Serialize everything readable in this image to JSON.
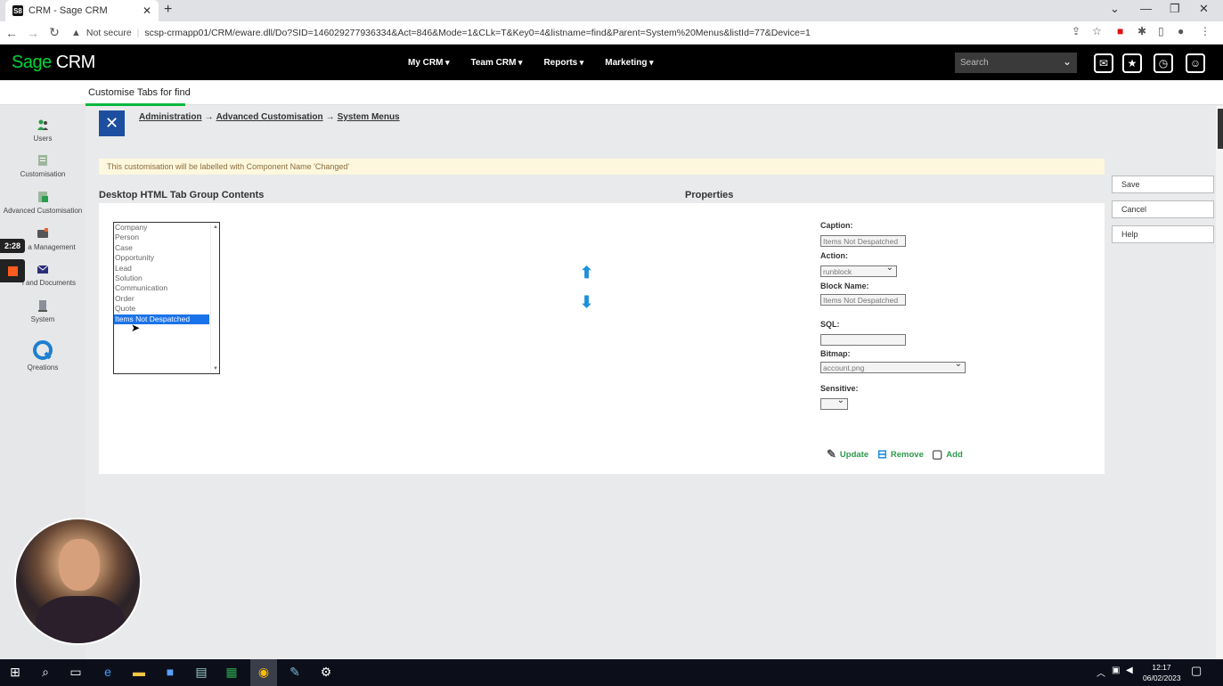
{
  "browser": {
    "tab_title": "CRM - Sage CRM",
    "tab_favicon": "S8",
    "new_tab": "+",
    "not_secure": "Not secure",
    "url": "scsp-crmapp01/CRM/eware.dll/Do?SID=146029277936334&Act=846&Mode=1&CLk=T&Key0=4&listname=find&Parent=System%20Menus&listId=77&Device=1"
  },
  "header": {
    "logo_sage": "Sage",
    "logo_crm": " CRM",
    "nav": [
      "My CRM",
      "Team CRM",
      "Reports",
      "Marketing"
    ],
    "search_placeholder": "Search"
  },
  "subheader": {
    "title": "Customise Tabs for find"
  },
  "sidebar": {
    "items": [
      "Users",
      "Customisation",
      "Advanced Customisation",
      "a Management",
      "l and Documents",
      "System",
      "Qreations"
    ]
  },
  "recorder": {
    "time": "2:28"
  },
  "breadcrumb": [
    "Administration",
    "Advanced Customisation",
    "System Menus"
  ],
  "breadcrumb_sep": "→",
  "notice": "This customisation will be labelled with Component Name 'Changed'",
  "sections": {
    "left": "Desktop HTML Tab Group Contents",
    "right": "Properties"
  },
  "tab_list": {
    "items": [
      "Company",
      "Person",
      "Case",
      "Opportunity",
      "Lead",
      "Solution",
      "Communication",
      "Order",
      "Quote",
      "Items Not Despatched"
    ],
    "selected_index": 9
  },
  "properties": {
    "caption_label": "Caption:",
    "caption_value": "Items Not Despatched",
    "action_label": "Action:",
    "action_value": "runblock",
    "block_name_label": "Block Name:",
    "block_name_value": "Items Not Despatched",
    "sql_label": "SQL:",
    "sql_value": "",
    "bitmap_label": "Bitmap:",
    "bitmap_value": "account.png",
    "sensitive_label": "Sensitive:",
    "sensitive_value": ""
  },
  "actions": {
    "update": "Update",
    "remove": "Remove",
    "add": "Add"
  },
  "side_buttons": {
    "save": "Save",
    "cancel": "Cancel",
    "help": "Help"
  },
  "taskbar": {
    "time": "12:17",
    "date": "06/02/2023"
  },
  "colors": {
    "accent": "#00b940",
    "header_bg": "#000000",
    "admin_icon": "#1c4f9f",
    "arrow": "#1e8fd8",
    "selected": "#1a73e8"
  }
}
